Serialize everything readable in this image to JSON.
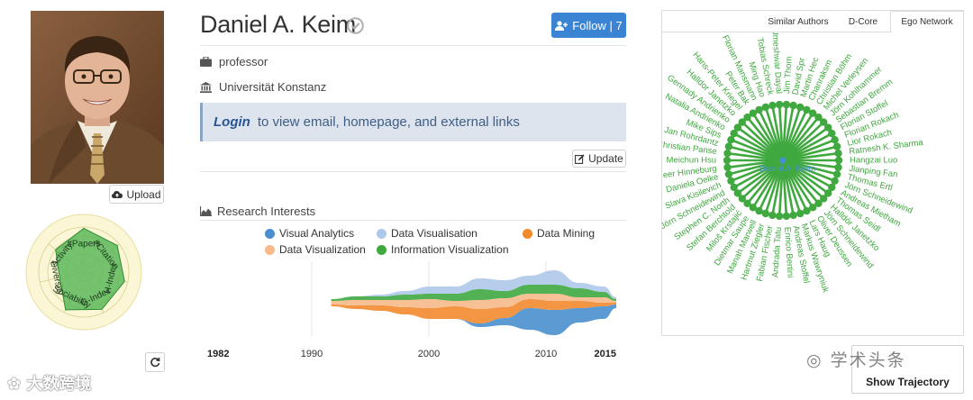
{
  "profile": {
    "name": "Daniel A. Keim",
    "position": "professor",
    "affiliation": "Universität Konstanz",
    "upload_label": "Upload",
    "follow_label": "Follow | 7",
    "login_link": "Login",
    "login_text": "to view email, homepage, and external links",
    "update_label": "Update"
  },
  "radar": {
    "axes": [
      "#Papers",
      "#Citation",
      "H-Index",
      "G-Index",
      "Sociability",
      "Diversity",
      "Activity"
    ],
    "values": [
      0.97,
      0.95,
      0.93,
      0.92,
      0.93,
      0.55,
      0.8
    ],
    "fill_color": "#5cb85c"
  },
  "research_interests": {
    "title": "Research Interests",
    "legend": [
      {
        "name": "Visual Analytics",
        "color": "#4a8fcf"
      },
      {
        "name": "Data Visualisation",
        "color": "#aec8ea"
      },
      {
        "name": "Data Mining",
        "color": "#f28a2e"
      },
      {
        "name": "Data Visualization",
        "color": "#f7b98a"
      },
      {
        "name": "Information Visualization",
        "color": "#3fa83f"
      }
    ],
    "axis_ticks": [
      "1982",
      "1990",
      "2000",
      "2010",
      "2015"
    ]
  },
  "chart_data": {
    "type": "area",
    "title": "Research Interests",
    "x": [
      1992,
      1994,
      1996,
      1998,
      2000,
      2002,
      2004,
      2006,
      2008,
      2010,
      2012,
      2014,
      2015
    ],
    "xlim": [
      1982,
      2015
    ],
    "series": [
      {
        "name": "Visual Analytics",
        "values": [
          0,
          0,
          0,
          0,
          0,
          0,
          2,
          4,
          12,
          14,
          8,
          7,
          2
        ]
      },
      {
        "name": "Data Mining",
        "values": [
          1,
          2,
          3,
          4,
          6,
          7,
          8,
          6,
          5,
          5,
          4,
          2,
          1
        ]
      },
      {
        "name": "Data Visualization",
        "values": [
          2,
          3,
          3,
          4,
          5,
          3,
          5,
          5,
          3,
          4,
          2,
          3,
          1
        ]
      },
      {
        "name": "Information Visualization",
        "values": [
          1,
          2,
          2,
          3,
          3,
          4,
          6,
          4,
          5,
          5,
          5,
          3,
          1
        ]
      },
      {
        "name": "Data Visualisation",
        "values": [
          0,
          0,
          1,
          2,
          4,
          4,
          6,
          6,
          5,
          8,
          3,
          3,
          1
        ]
      }
    ]
  },
  "ego_network": {
    "tabs": [
      "Similar Authors",
      "D-Core",
      "Ego Network"
    ],
    "active_tab": "Ego Network",
    "center": "Daniel A. Keim",
    "color": "#3fa83f",
    "nodes": [
      "Jim Thom",
      "David Spr",
      "Martin Hec",
      "Chanraksm",
      "Christian Böhm",
      "Michel Verleysen",
      "Jörn Kohlhammer",
      "Sebastian Bremm",
      "Florian Stoffel",
      "Florian Rokach",
      "Lior Rokach",
      "Ratnesh K. Sharma",
      "Hangzai Luo",
      "Jianping Fan",
      "Thomas Ertl",
      "Jörn Schneidewind",
      "Andreas Mietham",
      "Thomas Seidl",
      "Halldór Janetzko",
      "Jörn Schneidewind",
      "Oliver Deussen",
      "Lars Haug",
      "Markus Wawryniuk",
      "Andreas Stoffel",
      "Enrico Bertini",
      "Andrada Tatu",
      "Fabian Fischer",
      "Hartmut Ziegler",
      "Manah Marwell",
      "Dietmar Saupe",
      "Miloš Krstajić",
      "Stefan Berchtold",
      "Stephen C. North",
      "Jörn Schneidewind",
      "Slava Kisilevich",
      "Daniela Oelke",
      "Peer Hinneburg",
      "Meichun Hsu",
      "Christian Panse",
      "Jan Rohrdantz",
      "Mike Sips",
      "Natalia Andrienko",
      "Gennady Andrienko",
      "Halldor Janetzko",
      "Hans-Peter Kriegel",
      "Peter Bak",
      "Florian Mansmann",
      "Ming Hao",
      "Tobias Schreck",
      "Umeshwar Dayal"
    ]
  },
  "trajectory_label": "Show Trajectory",
  "watermarks": {
    "right": "学术头条",
    "left": "大数跨境"
  }
}
